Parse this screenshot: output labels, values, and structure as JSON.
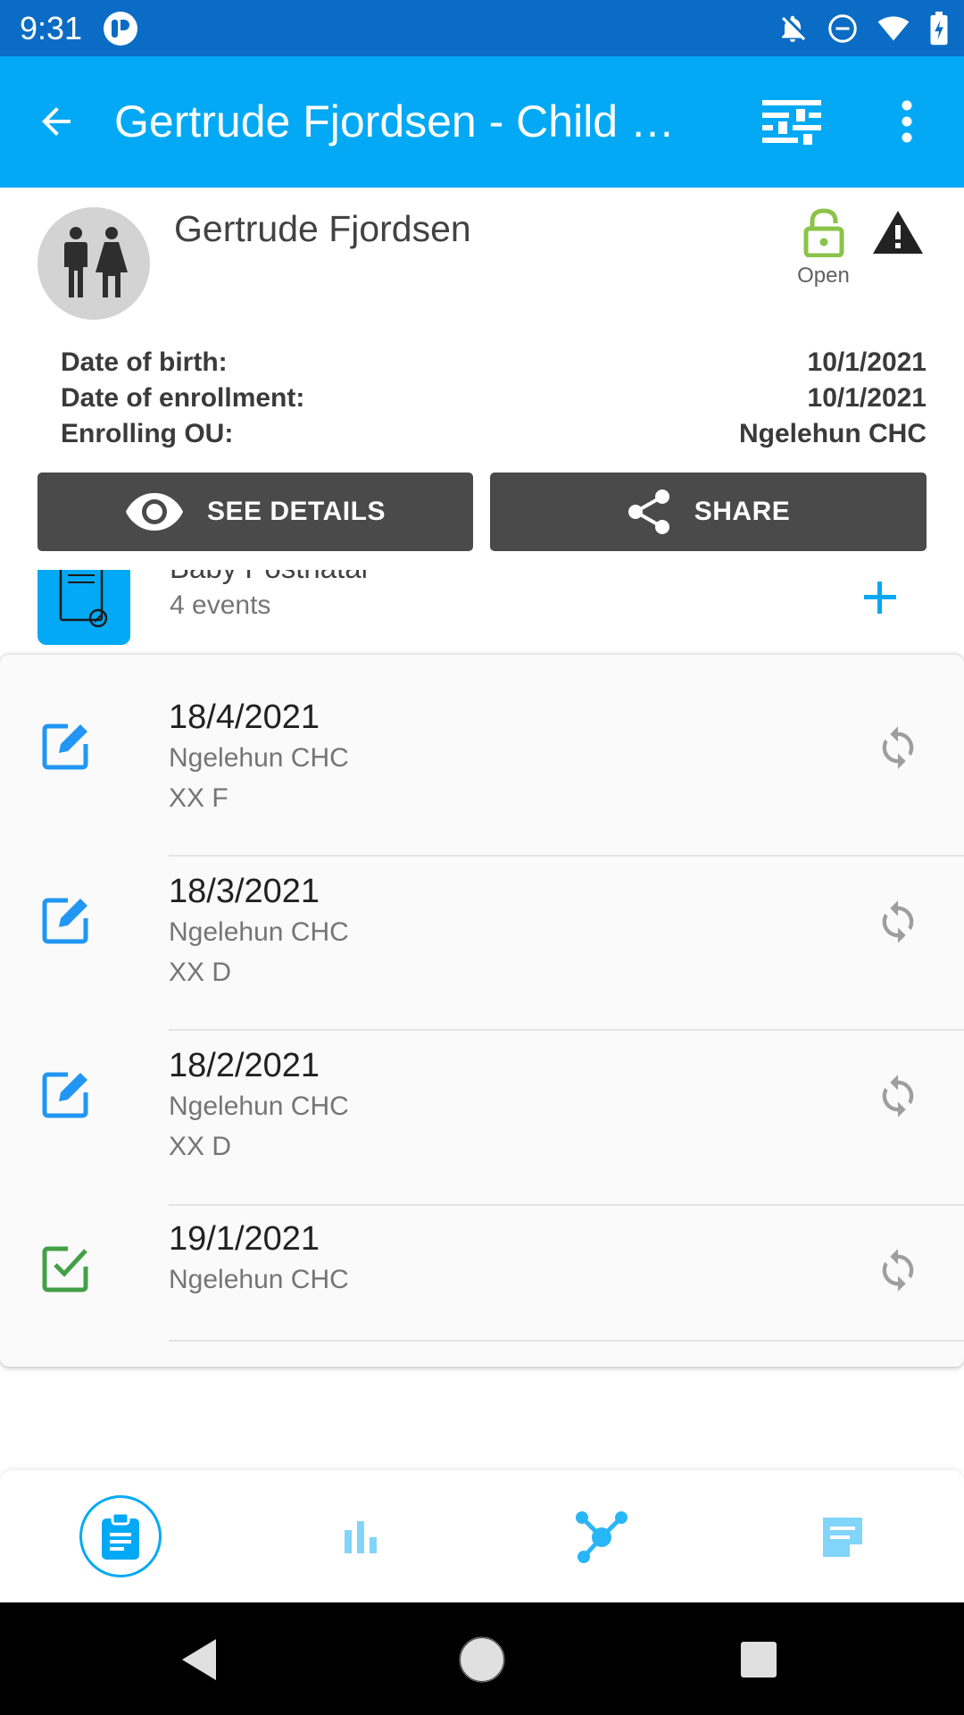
{
  "status_bar": {
    "time": "9:31",
    "icons": [
      "app-notification-icon",
      "notifications-off-icon",
      "do-not-disturb-icon",
      "wifi-icon",
      "battery-charging-icon"
    ]
  },
  "app_bar": {
    "title": "Gertrude Fjordsen - Child …",
    "icons": [
      "back-arrow-icon",
      "filter-icon",
      "more-vert-icon"
    ]
  },
  "header": {
    "name": "Gertrude Fjordsen",
    "status_label": "Open",
    "info": [
      {
        "label": "Date of birth:",
        "value": "10/1/2021"
      },
      {
        "label": "Date of enrollment:",
        "value": "10/1/2021"
      },
      {
        "label": "Enrolling OU:",
        "value": "Ngelehun CHC"
      }
    ],
    "see_details_label": "SEE DETAILS",
    "share_label": "SHARE"
  },
  "stage": {
    "name": "Baby Postnatal",
    "event_count": "4 events"
  },
  "events": [
    {
      "date": "18/4/2021",
      "org_unit": "Ngelehun CHC",
      "extra": "XX F",
      "status": "editable",
      "icon": "edit-icon"
    },
    {
      "date": "18/3/2021",
      "org_unit": "Ngelehun CHC",
      "extra": "XX D",
      "status": "editable",
      "icon": "edit-icon"
    },
    {
      "date": "18/2/2021",
      "org_unit": "Ngelehun CHC",
      "extra": "XX D",
      "status": "editable",
      "icon": "edit-icon"
    },
    {
      "date": "19/1/2021",
      "org_unit": "Ngelehun CHC",
      "extra": "",
      "status": "completed",
      "icon": "completed-check-icon"
    }
  ],
  "bottom_nav": {
    "items": [
      "events-clipboard-icon",
      "charts-icon",
      "relationships-icon",
      "notes-icon"
    ],
    "active_index": 0
  },
  "colors": {
    "status_bar": "#0a6cc4",
    "app_bar": "#03a9f4",
    "button_dark": "#4a4a4a",
    "edit_icon": "#2196f3",
    "complete_icon": "#43a047",
    "lock_open": "#8bc34a"
  }
}
